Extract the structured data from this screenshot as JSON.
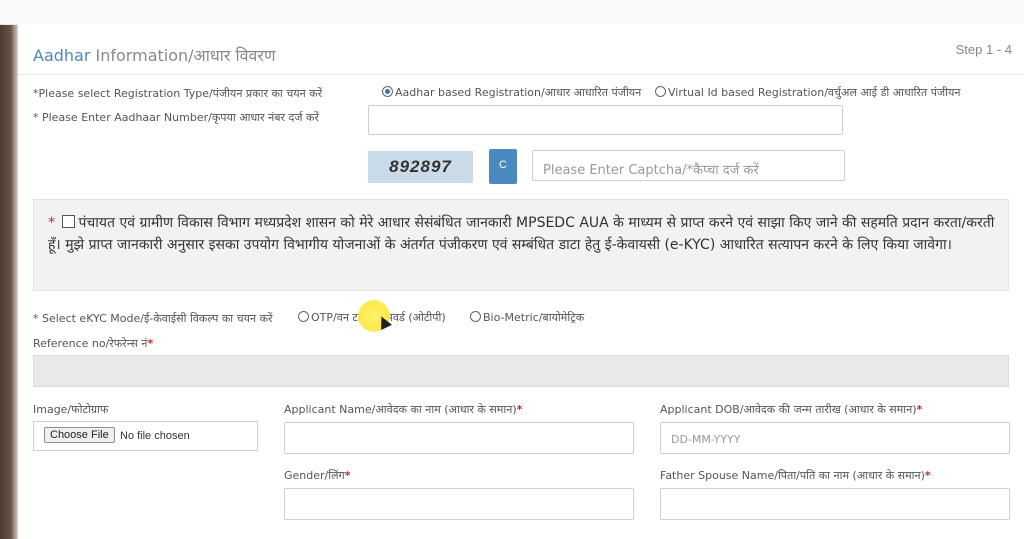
{
  "header": {
    "title_accent": "Aadhar",
    "title_rest": " Information/आधार विवरण",
    "step": "Step 1 - 4"
  },
  "registration": {
    "label": "*Please select Registration Type/पंजीयन प्रकार का चयन करें",
    "option_aadhar": "Aadhar based Registration/आधार आधारित पंजीयन",
    "option_virtual": "Virtual Id based Registration/वर्चुअल आई डी आधारित पंजीयन",
    "selected": "aadhar"
  },
  "aadhaar_number": {
    "label": "* Please Enter Aadhaar Number/कृपया आधार नंबर दर्ज करें",
    "value": ""
  },
  "captcha": {
    "code": "892897",
    "refresh_icon": "refresh-icon",
    "refresh_glyph": "C",
    "placeholder": "Please Enter Captcha/*कैप्चा दर्ज करें"
  },
  "consent": {
    "star": "*",
    "text": "पंचायत एवं ग्रामीण विकास विभाग मध्यप्रदेश शासन को मेरे आधार सेसंबंधित जानकारी MPSEDC AUA के माध्यम से प्राप्त करने एवं साझा किए जाने की सहमति प्रदान करता/करती हूँ। मुझे प्राप्त जानकारी अनुसार इसका उपयोग विभागीय योजनाओं के अंतर्गत पंजीकरण एवं सम्बंधित डाटा हेतु ई-केवायसी (e-KYC) आधारित सत्यापन करने के लिए किया जावेगा।"
  },
  "ekyc": {
    "label": "* Select eKYC Mode/ई-केवाईसी विकल्प का चयन करें",
    "option_otp": "OTP/वन टाइम पासवर्ड (ओटीपी)",
    "option_bio": "Bio-Metric/बायोमेट्रिक"
  },
  "reference": {
    "label": "Reference no/रेफरेन्स नं",
    "star": "*",
    "value": ""
  },
  "image": {
    "label": "Image/फोटोग्राफ",
    "button": "Choose File",
    "status": "No file chosen"
  },
  "applicant_name": {
    "label": "Applicant Name/आवेदक का नाम (आधार के समान)",
    "star": "*"
  },
  "applicant_dob": {
    "label": "Applicant DOB/आवेदक की जन्म तारीख (आधार के समान)",
    "star": "*",
    "placeholder": "DD-MM-YYYY"
  },
  "gender": {
    "label": "Gender/लिंग",
    "star": "*"
  },
  "father_spouse": {
    "label": "Father Spouse Name/पिता/पति का नाम (आधार के समान)",
    "star": "*"
  }
}
